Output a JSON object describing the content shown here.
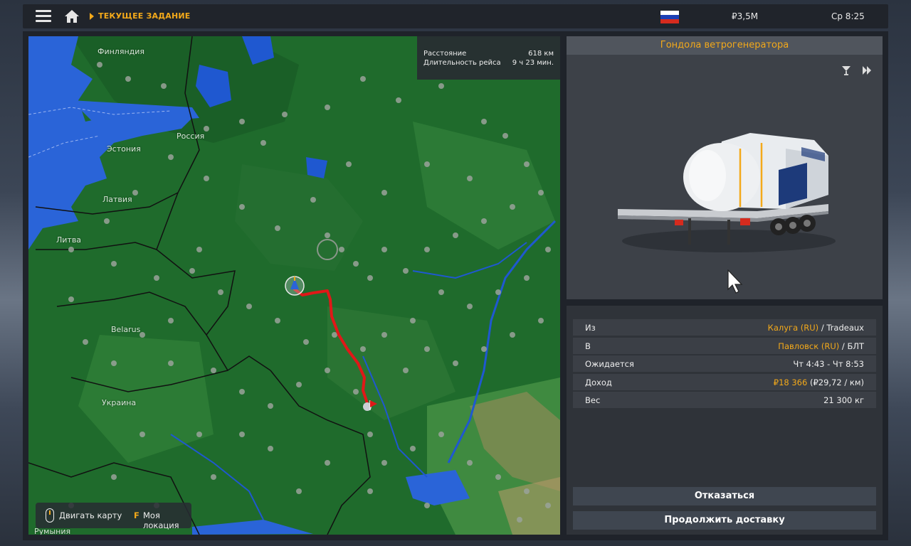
{
  "topbar": {
    "breadcrumb": "ТЕКУЩЕЕ ЗАДАНИЕ",
    "money": "₽3,5M",
    "clock": "Ср 8:25",
    "flag_colors": [
      "#ffffff",
      "#1c3fb4",
      "#d52b1e"
    ]
  },
  "map": {
    "distance_label": "Расстояние",
    "distance_value": "618 км",
    "duration_label": "Длительность рейса",
    "duration_value": "9 ч 23 мин.",
    "countries": {
      "finland": "Финляндия",
      "russia": "Россия",
      "estonia": "Эстония",
      "latvia": "Латвия",
      "lithuania": "Литва",
      "belarus": "Belarus",
      "ukraine": "Украина",
      "romania": "Румыния"
    },
    "hint_move": "Двигать карту",
    "hint_key": "F",
    "hint_location": "Моя локация",
    "colors": {
      "land": "#1f6b2c",
      "sea": "#2a64d8",
      "route": "#e01818"
    }
  },
  "cargo": {
    "title": "Гондола ветрогенератора"
  },
  "info": {
    "rows": [
      {
        "key": "Из",
        "city": "Калуга (RU)",
        "sep": " / ",
        "company": "Tradeaux"
      },
      {
        "key": "В",
        "city": "Павловск (RU)",
        "sep": " / ",
        "company": "БЛТ"
      },
      {
        "key": "Ожидается",
        "value": "Чт 4:43 - Чт 8:53"
      },
      {
        "key": "Доход",
        "value": "₽18 366",
        "extra": " (₽29,72 / км)"
      },
      {
        "key": "Вес",
        "value": "21 300 кг"
      }
    ]
  },
  "buttons": {
    "decline": "Отказаться",
    "continue": "Продолжить доставку"
  }
}
